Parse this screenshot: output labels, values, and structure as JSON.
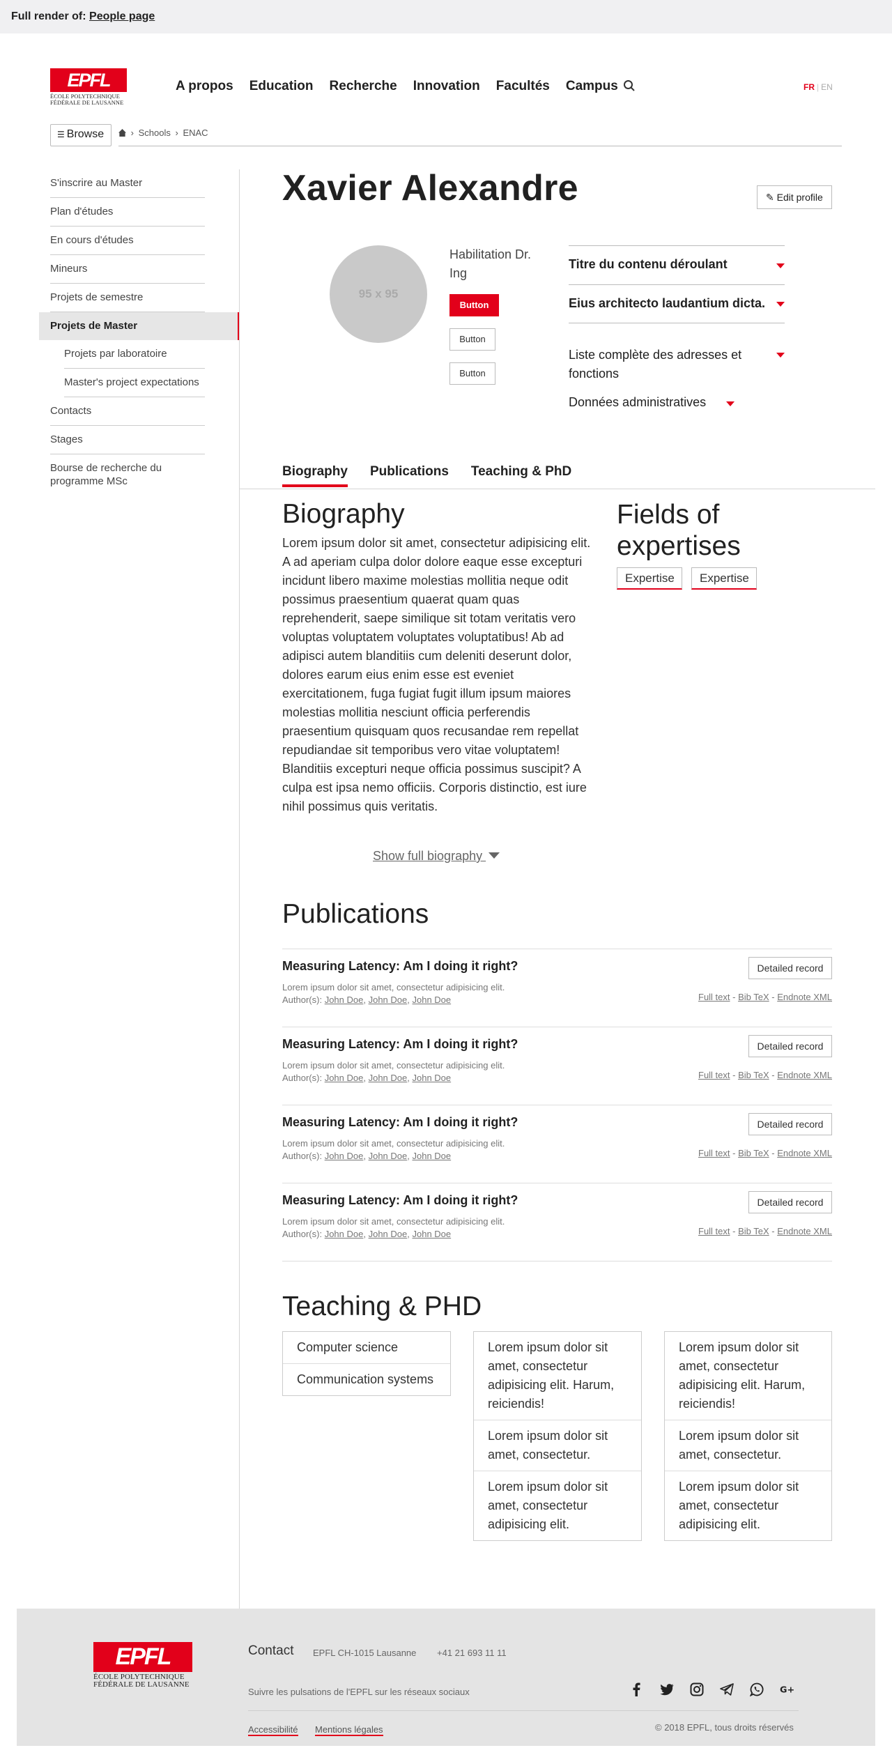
{
  "banner": {
    "prefix": "Full render of:",
    "link": "People page"
  },
  "logo": {
    "mark": "EPFL",
    "line1": "ÉCOLE POLYTECHNIQUE",
    "line2": "FÉDÉRALE DE LAUSANNE"
  },
  "nav": [
    "A propos",
    "Education",
    "Recherche",
    "Innovation",
    "Facultés",
    "Campus"
  ],
  "langs": {
    "fr": "FR",
    "sep": "|",
    "en": "EN"
  },
  "browse": {
    "icon": "list-icon",
    "label": "Browse"
  },
  "breadcrumb": {
    "sep": "›",
    "items": [
      "Schools",
      "ENAC"
    ]
  },
  "sidebar": [
    "S'inscrire au Master",
    "Plan d'études",
    "En cours d'études",
    "Mineurs",
    "Projets de semestre",
    "Projets de Master",
    "Projets par laboratoire",
    "Master's project expectations",
    "Contacts",
    "Stages",
    "Bourse de recherche du programme MSc"
  ],
  "profile": {
    "name": "Xavier Alexandre",
    "edit_label": "Edit profile",
    "avatar": "95 x 95",
    "title": "Habilitation Dr. Ing",
    "buttons": [
      "Button",
      "Button",
      "Button"
    ],
    "dropdowns": [
      "Titre du contenu déroulant",
      "Eius architecto laudantium dicta.",
      "Liste complète des adresses et fonctions",
      "Données administratives"
    ]
  },
  "tabs": [
    "Biography",
    "Publications",
    "Teaching & PhD"
  ],
  "biography": {
    "title": "Biography",
    "text": "Lorem ipsum dolor sit amet, consectetur adipisicing elit. A ad aperiam culpa dolor dolore eaque esse excepturi incidunt libero maxime molestias mollitia neque odit possimus praesentium quaerat quam quas reprehenderit, saepe similique sit totam veritatis vero voluptas voluptatem voluptates voluptatibus! Ab ad adipisci autem blanditiis cum deleniti deserunt dolor, dolores earum eius enim esse est eveniet exercitationem, fuga fugiat fugit illum ipsum maiores molestias mollitia nesciunt officia perferendis praesentium quisquam quos recusandae rem repellat repudiandae sit temporibus vero vitae voluptatem! Blanditiis excepturi neque officia possimus suscipit? A culpa est ipsa nemo officiis. Corporis distinctio, est iure nihil possimus quis veritatis.",
    "show_full": "Show full biography "
  },
  "fields": {
    "title": "Fields of expertises",
    "tags": [
      "Expertise",
      "Expertise"
    ]
  },
  "publications": {
    "title": "Publications",
    "button": "Detailed record",
    "author_prefix": "Author(s):",
    "link_sep": " - ",
    "items": [
      {
        "title": "Measuring Latency: Am I doing it right?",
        "desc": "Lorem ipsum dolor sit amet, consectetur adipisicing elit.",
        "authors": [
          "John Doe",
          "John Doe",
          "John Doe"
        ],
        "links": [
          "Full text",
          "Bib TeX",
          "Endnote XML"
        ]
      },
      {
        "title": "Measuring Latency: Am I doing it right?",
        "desc": "Lorem ipsum dolor sit amet, consectetur adipisicing elit.",
        "authors": [
          "John Doe",
          "John Doe",
          "John Doe"
        ],
        "links": [
          "Full text",
          "Bib TeX",
          "Endnote XML"
        ]
      },
      {
        "title": "Measuring Latency: Am I doing it right?",
        "desc": "Lorem ipsum dolor sit amet, consectetur adipisicing elit.",
        "authors": [
          "John Doe",
          "John Doe",
          "John Doe"
        ],
        "links": [
          "Full text",
          "Bib TeX",
          "Endnote XML"
        ]
      },
      {
        "title": "Measuring Latency: Am I doing it right?",
        "desc": "Lorem ipsum dolor sit amet, consectetur adipisicing elit.",
        "authors": [
          "John Doe",
          "John Doe",
          "John Doe"
        ],
        "links": [
          "Full text",
          "Bib TeX",
          "Endnote XML"
        ]
      }
    ]
  },
  "teaching": {
    "title": "Teaching & PHD",
    "col1": [
      "Computer science",
      "Communication systems"
    ],
    "col2": [
      "Lorem ipsum dolor sit amet, consectetur adipisicing elit. Harum, reiciendis!",
      "Lorem ipsum dolor sit amet, consectetur.",
      "Lorem ipsum dolor sit amet, consectetur adipisicing elit."
    ],
    "col3": [
      "Lorem ipsum dolor sit amet, consectetur adipisicing elit. Harum, reiciendis!",
      "Lorem ipsum dolor sit amet, consectetur.",
      "Lorem ipsum dolor sit amet, consectetur adipisicing elit."
    ]
  },
  "footer": {
    "contact": "Contact",
    "address": "EPFL CH-1015 Lausanne",
    "phone": "+41 21 693 11 11",
    "social_text": "Suivre les pulsations de l'EPFL sur les réseaux sociaux",
    "social_icons": [
      "facebook-icon",
      "twitter-icon",
      "instagram-icon",
      "telegram-icon",
      "whatsapp-icon",
      "google-plus-icon"
    ],
    "links": [
      "Accessibilité",
      "Mentions légales"
    ],
    "copyright": "© 2018 EPFL, tous droits réservés"
  },
  "colors": {
    "accent": "#e2001a",
    "footer_bg": "#e4e4e4",
    "banner_bg": "#f0f0f2"
  }
}
